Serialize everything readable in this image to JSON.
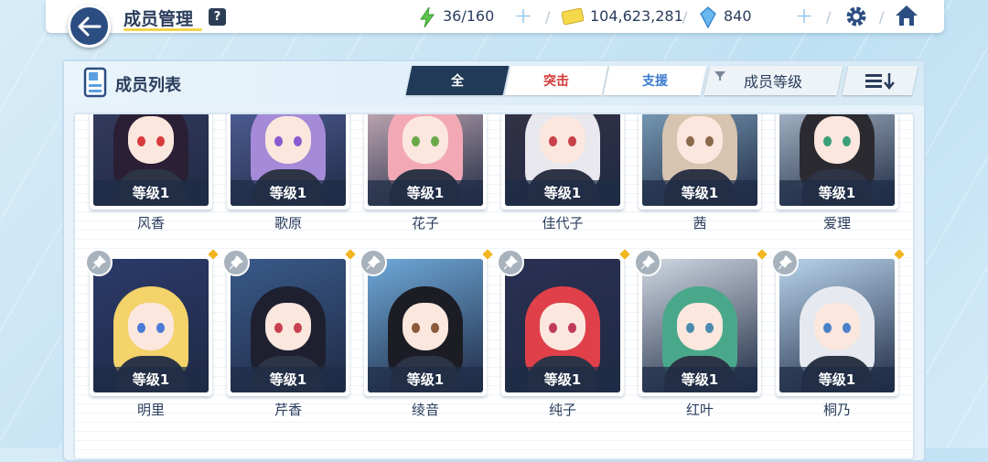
{
  "header": {
    "title": "成员管理",
    "help_label": "?",
    "stamina": "36/160",
    "credits": "104,623,281",
    "gems": "840"
  },
  "panel": {
    "title": "成员列表",
    "tabs": [
      {
        "label": "全",
        "color": "#ffffff",
        "active": true
      },
      {
        "label": "突击",
        "color": "#d43a3a",
        "active": false
      },
      {
        "label": "支援",
        "color": "#3b7bd0",
        "active": false
      }
    ],
    "sort_label": "成员等级"
  },
  "rows": [
    {
      "members": [
        {
          "name": "风香",
          "level": "等级1",
          "bg": "#3a3f63",
          "hair": "#2a1f35",
          "eye": "#d63a3a"
        },
        {
          "name": "歌原",
          "level": "等级1",
          "bg": "#5a6aa8",
          "hair": "#a58ad8",
          "eye": "#8a5ad0"
        },
        {
          "name": "花子",
          "level": "等级1",
          "bg": "#e9c8cf",
          "hair": "#f2a9b5",
          "eye": "#6aa84a"
        },
        {
          "name": "佳代子",
          "level": "等级1",
          "bg": "#3a3446",
          "hair": "#e8e8ee",
          "eye": "#c8404a"
        },
        {
          "name": "茜",
          "level": "等级1",
          "bg": "#8fb8d4",
          "hair": "#d6c4b0",
          "eye": "#8a6a4a"
        },
        {
          "name": "爱理",
          "level": "等级1",
          "bg": "#c6d7e6",
          "hair": "#2a2a30",
          "eye": "#3aa07a"
        }
      ]
    },
    {
      "members": [
        {
          "name": "明里",
          "level": "等级1",
          "bg": "#2b3a6a",
          "hair": "#f3d36a",
          "eye": "#4a7ad8"
        },
        {
          "name": "芹香",
          "level": "等级1",
          "bg": "#3a5a8a",
          "hair": "#1e2030",
          "eye": "#c84050"
        },
        {
          "name": "绫音",
          "level": "等级1",
          "bg": "#6ea8d8",
          "hair": "#1c1c24",
          "eye": "#8a5a3a"
        },
        {
          "name": "纯子",
          "level": "等级1",
          "bg": "#2a3052",
          "hair": "#e0404a",
          "eye": "#c03a5a"
        },
        {
          "name": "红叶",
          "level": "等级1",
          "bg": "#cfd8e2",
          "hair": "#4aa88a",
          "eye": "#4a8ab0"
        },
        {
          "name": "桐乃",
          "level": "等级1",
          "bg": "#b8d4ec",
          "hair": "#e6eaf0",
          "eye": "#4a80c8"
        }
      ]
    }
  ]
}
